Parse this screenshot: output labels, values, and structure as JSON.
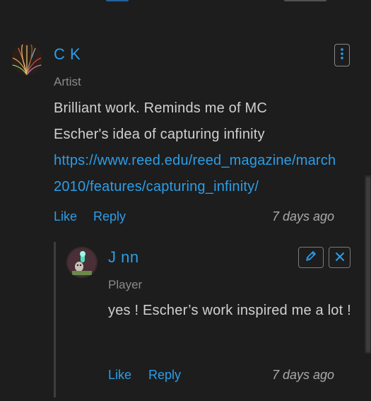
{
  "comments": [
    {
      "author": "C K",
      "role": "Artist",
      "text": "Brilliant work. Reminds me of MC Escher's idea of capturing infinity",
      "link": "https://www.reed.edu/reed_magazine/march2010/features/capturing_infinity/",
      "like_label": "Like",
      "reply_label": "Reply",
      "timestamp": "7 days ago",
      "menu_icon": "kebab-menu-icon"
    }
  ],
  "reply": {
    "author": "J nn",
    "role": "Player",
    "text": "yes ! Escher’s work inspired me a lot !",
    "like_label": "Like",
    "reply_label": "Reply",
    "timestamp": "7 days ago",
    "edit_icon": "pencil-icon",
    "delete_icon": "close-icon"
  },
  "colors": {
    "background": "#1d1d1d",
    "accent": "#2b9ee9",
    "muted": "#8a8a8a",
    "text": "#d0d0d0"
  }
}
